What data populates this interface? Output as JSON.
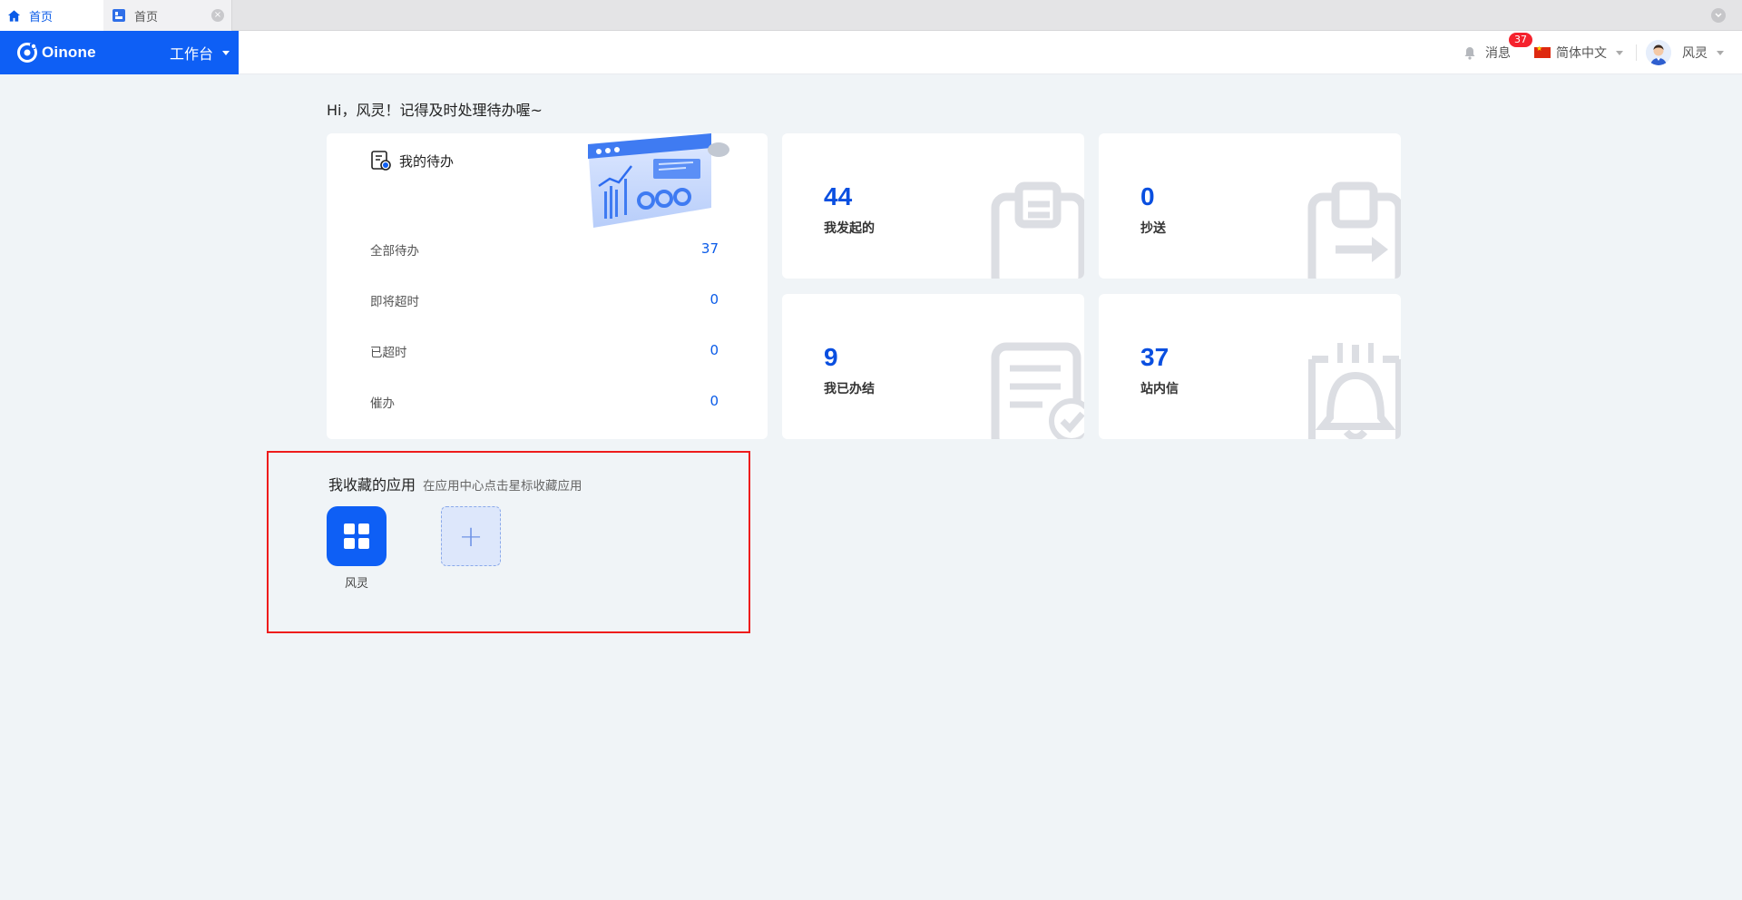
{
  "browser_tabs": [
    {
      "label": "首页",
      "icon": "home-icon",
      "active": true
    },
    {
      "label": "首页",
      "icon": "app-page-icon",
      "active": false
    }
  ],
  "header": {
    "brand_name": "Oinone",
    "workbench_label": "工作台",
    "messages_label": "消息",
    "messages_badge": "37",
    "language_label": "简体中文",
    "user_name": "风灵"
  },
  "greeting": "Hi，风灵！记得及时处理待办喔~",
  "todo": {
    "title": "我的待办",
    "rows": [
      {
        "label": "全部待办",
        "value": "37"
      },
      {
        "label": "即将超时",
        "value": "0"
      },
      {
        "label": "已超时",
        "value": "0"
      },
      {
        "label": "催办",
        "value": "0"
      }
    ]
  },
  "stats": [
    {
      "value": "44",
      "label": "我发起的",
      "icon": "clipboard-icon"
    },
    {
      "value": "0",
      "label": "抄送",
      "icon": "clipboard-forward-icon"
    },
    {
      "value": "9",
      "label": "我已办结",
      "icon": "document-check-icon"
    },
    {
      "value": "37",
      "label": "站内信",
      "icon": "bell-icon"
    }
  ],
  "favorites": {
    "title": "我收藏的应用",
    "hint": "在应用中心点击星标收藏应用",
    "apps": [
      {
        "name": "风灵",
        "icon": "grid-icon"
      }
    ],
    "add_icon": "+"
  },
  "colors": {
    "brand": "#0e5ff5",
    "stat_number": "#0a4fe0",
    "badge": "#f5222d",
    "highlight_border": "#ee1c1c"
  }
}
